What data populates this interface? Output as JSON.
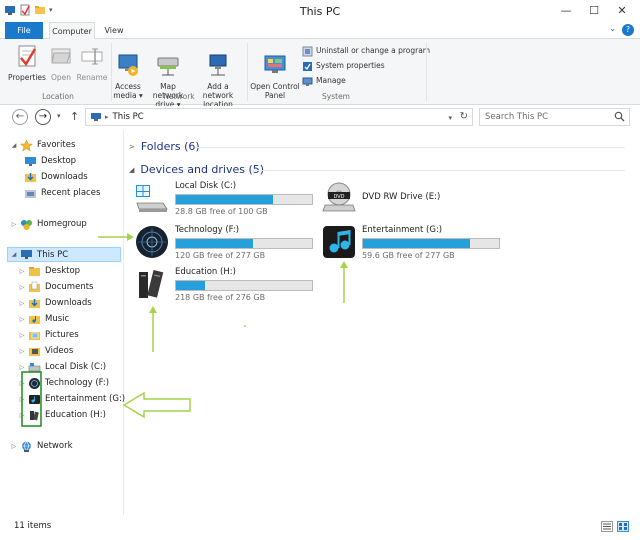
{
  "window": {
    "title": "This PC",
    "minimize": "—",
    "maximize": "☐",
    "close": "✕"
  },
  "ribbon_tabs": [
    {
      "label": "File"
    },
    {
      "label": "Computer"
    },
    {
      "label": "View"
    }
  ],
  "ribbon": {
    "location": {
      "label": "Location",
      "properties": "Properties",
      "open": "Open",
      "rename": "Rename"
    },
    "network": {
      "label": "Network",
      "access_media": "Access\nmedia ▾",
      "map_network_drive": "Map network\ndrive ▾",
      "add_network_location": "Add a network\nlocation"
    },
    "system": {
      "label": "System",
      "open_control_panel": "Open Control\nPanel",
      "uninstall": "Uninstall or change a program",
      "system_properties": "System properties",
      "manage": "Manage"
    }
  },
  "address_bar": {
    "path": "This PC",
    "search_placeholder": "Search This PC"
  },
  "nav_pane": {
    "favorites": "Favorites",
    "desktop_fav": "Desktop",
    "downloads_fav": "Downloads",
    "recent_places": "Recent places",
    "homegroup": "Homegroup",
    "this_pc": "This PC",
    "desktop": "Desktop",
    "documents": "Documents",
    "downloads": "Downloads",
    "music": "Music",
    "pictures": "Pictures",
    "videos": "Videos",
    "local_disk": "Local Disk (C:)",
    "technology": "Technology (F:)",
    "entertainment": "Entertainment (G:)",
    "education": "Education (H:)",
    "network": "Network"
  },
  "content": {
    "folders_header": "Folders (6)",
    "devices_header": "Devices and drives (5)",
    "drives": [
      {
        "name": "Local Disk (C:)",
        "free": "28.8 GB free of 100 GB",
        "used_fraction": 0.712
      },
      {
        "name": "DVD RW Drive (E:)",
        "free": "",
        "used_fraction": 0
      },
      {
        "name": "Technology (F:)",
        "free": "120 GB free of 277 GB",
        "used_fraction": 0.567
      },
      {
        "name": "Entertainment (G:)",
        "free": "59.6 GB free of 277 GB",
        "used_fraction": 0.785
      },
      {
        "name": "Education (H:)",
        "free": "218 GB free of 276 GB",
        "used_fraction": 0.21
      }
    ]
  },
  "status": {
    "item_count": "11 items"
  },
  "colors": {
    "accent": "#1979ca",
    "drive_bar": "#26a0da",
    "selection": "#cde8ff",
    "annotation_arrow": "#a4d44a",
    "annotation_box": "#1a8c1a"
  }
}
